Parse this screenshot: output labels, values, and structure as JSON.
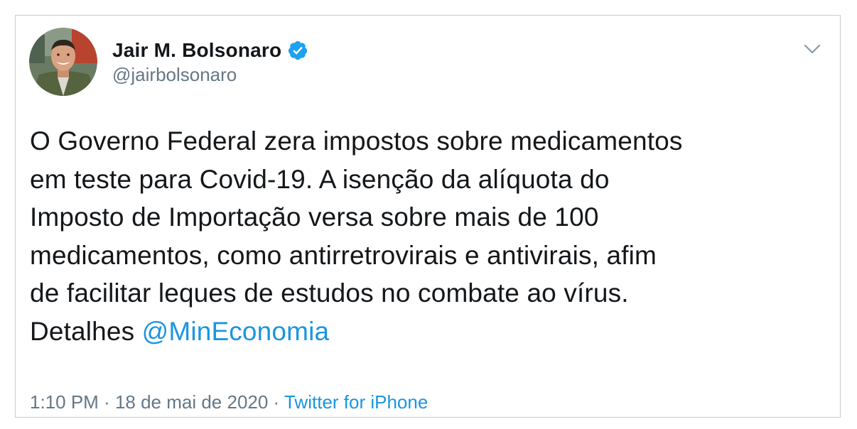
{
  "tweet": {
    "author_name": "Jair M. Bolsonaro",
    "author_handle": "@jairbolsonaro",
    "verified_icon": "verified-badge-icon",
    "menu_icon": "chevron-down-icon",
    "text_lines": [
      "O Governo Federal zera impostos sobre medicamentos",
      "em teste para Covid-19. A isenção da alíquota do",
      "Imposto de Importação versa sobre mais de 100",
      "medicamentos, como antirretrovirais e antivirais, afim",
      "de facilitar leques de estudos no combate ao vírus."
    ],
    "last_line_prefix": "Detalhes ",
    "mention": "@MinEconomia",
    "time": "1:10 PM",
    "separator": " · ",
    "date": "18 de mai de 2020",
    "source": "Twitter for iPhone"
  },
  "colors": {
    "text": "#14171a",
    "secondary": "#657786",
    "link": "#1b95e0",
    "verified": "#1da1f2",
    "border": "#c7cdd1"
  }
}
